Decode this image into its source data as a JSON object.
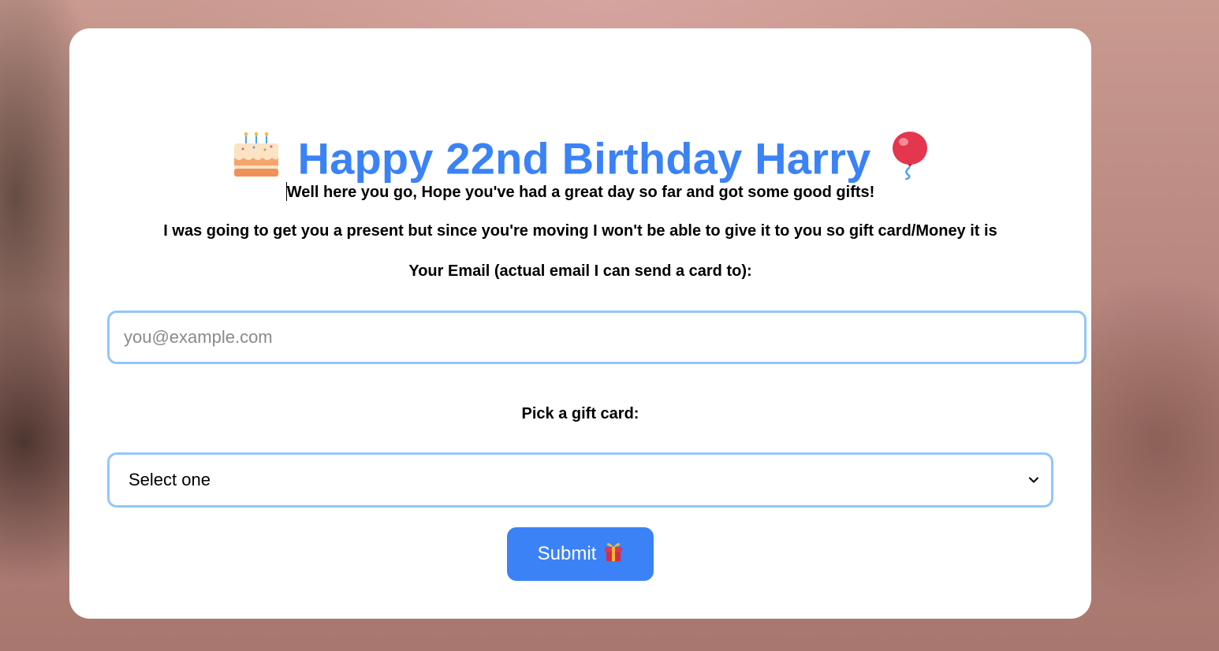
{
  "card": {
    "title_text": "Happy 22nd Birthday Harry",
    "title_emoji_left": "cake-icon",
    "title_emoji_right": "balloon-icon",
    "message_1": "Well here you go, Hope you've had a great day so far and got some good gifts!",
    "message_2": "I was going to get you a present but since you're moving I won't be able to give it to you so gift card/Money it is",
    "email_label": "Your Email (actual email I can send a card to):",
    "email_placeholder": "you@example.com",
    "email_value": "",
    "giftcard_label": "Pick a gift card:",
    "giftcard_selected": "Select one",
    "submit_label": "Submit",
    "submit_icon": "gift-icon"
  },
  "colors": {
    "accent": "#3b82f6",
    "input_border": "#93c5fd",
    "card_bg": "#ffffff"
  }
}
